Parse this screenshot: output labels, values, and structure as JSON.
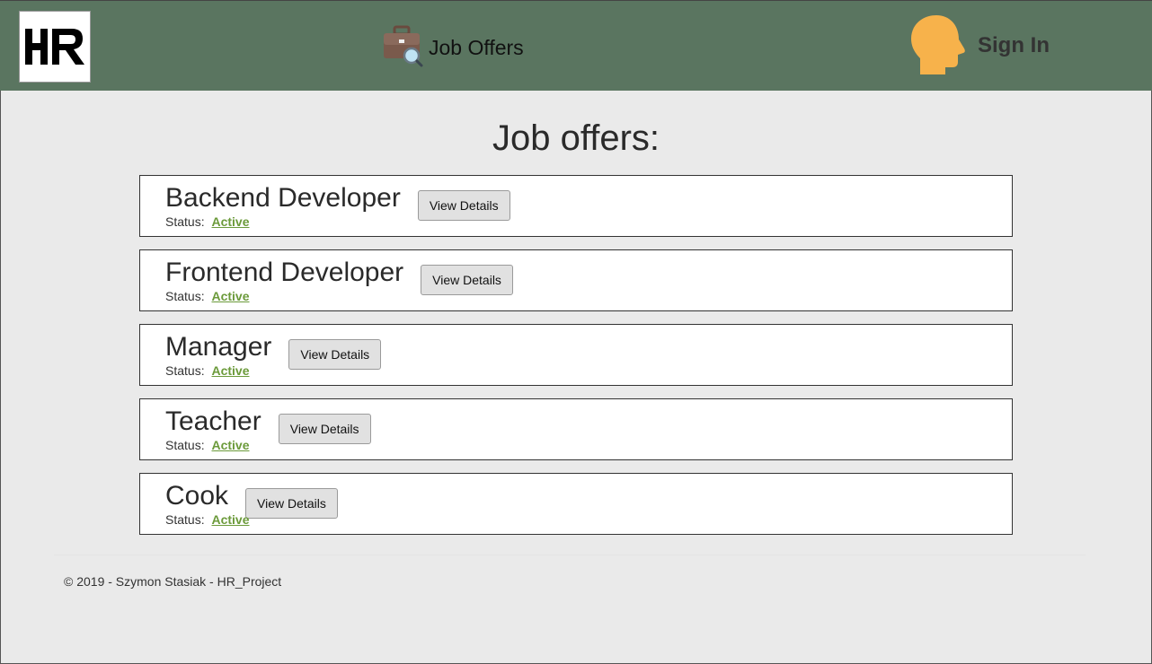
{
  "header": {
    "logo_text": "HR",
    "nav_link_label": "Job Offers",
    "nav_link_icon": "briefcase-search-icon",
    "signin_label": "Sign In",
    "signin_icon": "user-head-icon",
    "colors": {
      "navbar": "#5a7560",
      "briefcase": "#7a5a4c",
      "head": "#f7b24b",
      "status_active": "#6b9a3a"
    }
  },
  "main": {
    "title": "Job offers:",
    "status_label": "Status:",
    "offers": [
      {
        "title": "Backend Developer",
        "status": "Active",
        "button_label": "View Details"
      },
      {
        "title": "Frontend Developer",
        "status": "Active",
        "button_label": "View Details"
      },
      {
        "title": "Manager",
        "status": "Active",
        "button_label": "View Details"
      },
      {
        "title": "Teacher",
        "status": "Active",
        "button_label": "View Details"
      },
      {
        "title": "Cook",
        "status": "Active",
        "button_label": "View Details"
      }
    ]
  },
  "footer": {
    "text": "© 2019 - Szymon Stasiak - HR_Project"
  }
}
